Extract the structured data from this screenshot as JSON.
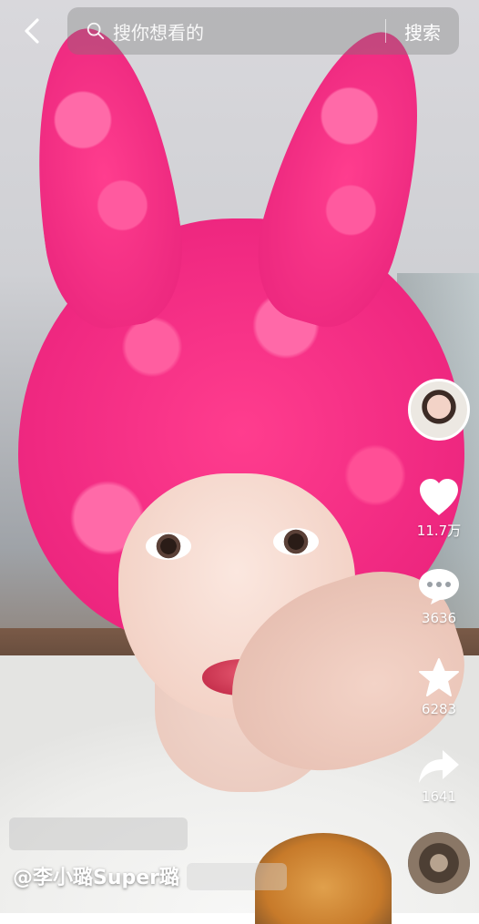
{
  "search": {
    "placeholder": "搜你想看的",
    "button_label": "搜索"
  },
  "rail": {
    "like_count": "11.7万",
    "comment_count": "3636",
    "favorite_count": "6283",
    "share_count": "1641"
  },
  "video": {
    "author": "@李小璐Super璐"
  },
  "icons": {
    "back": "chevron-left-icon",
    "search": "magnifier-icon",
    "like": "heart-icon",
    "comment": "comment-bubble-icon",
    "favorite": "star-icon",
    "share": "share-arrow-icon"
  },
  "colors": {
    "hat_pink": "#ff3d8e",
    "text": "#ffffff"
  }
}
